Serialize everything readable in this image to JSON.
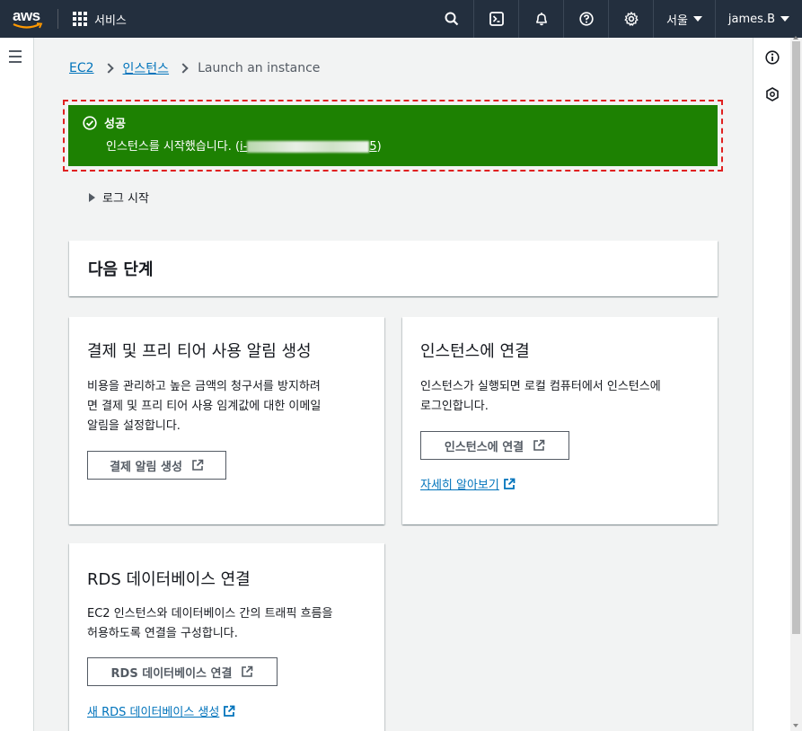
{
  "topbar": {
    "logo": "aws",
    "services_label": "서비스",
    "region": "서울",
    "user": "james.B",
    "icons": [
      "search-icon",
      "cloudshell-icon",
      "bell-icon",
      "help-icon",
      "gear-icon"
    ]
  },
  "breadcrumb": {
    "items": [
      "EC2",
      "인스턴스"
    ],
    "current": "Launch an instance"
  },
  "flash": {
    "title": "성공",
    "message_prefix": "인스턴스를 시작했습니다. (",
    "instance_id_start": "i-",
    "instance_id_end": "5",
    "message_suffix": ")"
  },
  "log_toggle": "로그 시작",
  "next_steps": {
    "title": "다음 단계"
  },
  "cards": {
    "billing": {
      "title": "결제 및 프리 티어 사용 알림 생성",
      "body_line1": "비용을 관리하고 높은 금액의 청구서를 방지하려",
      "body_line2": "면 결제 및 프리 티어 사용 임계값에 대한 이메일",
      "body_line3": "알림을 설정합니다.",
      "button": "결제 알림 생성"
    },
    "connect": {
      "title": "인스턴스에 연결",
      "body_line1": "인스턴스가 실행되면 로컬 컴퓨터에서 인스턴스에",
      "body_line2": "로그인합니다.",
      "button": "인스턴스에 연결",
      "link": "자세히 알아보기"
    },
    "rds": {
      "title": "RDS 데이터베이스 연결",
      "body_line1": "EC2 인스턴스와 데이터베이스 간의 트래픽 흐름을",
      "body_line2": "허용하도록 연결을 구성합니다.",
      "button": "RDS 데이터베이스 연결",
      "link": "새 RDS 데이터베이스 생성"
    }
  },
  "colors": {
    "nav_bg": "#232f3e",
    "success": "#1d8102",
    "link": "#0073bb",
    "highlight_border": "#e02020"
  }
}
